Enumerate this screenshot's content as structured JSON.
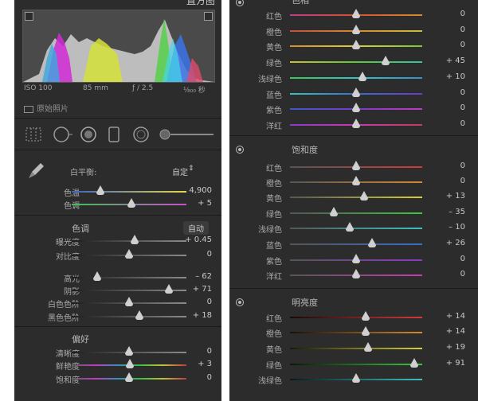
{
  "histogram": {
    "title": "直方图",
    "iso": "ISO 100",
    "focal": "85 mm",
    "aperture": "ƒ / 2.5",
    "shutter": "¹⁄₈₀₀ 秒",
    "original_photo_label": "原始照片"
  },
  "basic": {
    "wb_label": "白平衡:",
    "wb_value": "自定",
    "temp": {
      "label": "色温",
      "value": "4,900",
      "pos": 0.25
    },
    "tint": {
      "label": "色调",
      "value": "+ 5",
      "pos": 0.52
    },
    "tone_title": "色调",
    "auto_label": "自动",
    "exposure": {
      "label": "曝光度",
      "value": "+ 0.45",
      "pos": 0.55
    },
    "contrast": {
      "label": "对比度",
      "value": "0",
      "pos": 0.5
    },
    "highlights": {
      "label": "高光",
      "value": "– 62",
      "pos": 0.22
    },
    "shadows": {
      "label": "阴影",
      "value": "+ 71",
      "pos": 0.85
    },
    "whites": {
      "label": "白色色阶",
      "value": "0",
      "pos": 0.5
    },
    "blacks": {
      "label": "黑色色阶",
      "value": "+ 18",
      "pos": 0.59
    },
    "presence_title": "偏好",
    "clarity": {
      "label": "清晰度",
      "value": "0",
      "pos": 0.5
    },
    "vibrance": {
      "label": "鲜艳度",
      "value": "+ 3",
      "pos": 0.51
    },
    "saturation": {
      "label": "饱和度",
      "value": "0",
      "pos": 0.5
    }
  },
  "hsl": {
    "hue_title": "色相",
    "sat_title": "饱和度",
    "lum_title": "明亮度",
    "hue": [
      {
        "label": "红色",
        "value": "0",
        "pos": 0.5
      },
      {
        "label": "橙色",
        "value": "0",
        "pos": 0.5
      },
      {
        "label": "黄色",
        "value": "0",
        "pos": 0.5
      },
      {
        "label": "绿色",
        "value": "+ 45",
        "pos": 0.72
      },
      {
        "label": "浅绿色",
        "value": "+ 10",
        "pos": 0.55
      },
      {
        "label": "蓝色",
        "value": "0",
        "pos": 0.5
      },
      {
        "label": "紫色",
        "value": "0",
        "pos": 0.5
      },
      {
        "label": "洋红",
        "value": "0",
        "pos": 0.5
      }
    ],
    "sat": [
      {
        "label": "红色",
        "value": "0",
        "pos": 0.5
      },
      {
        "label": "橙色",
        "value": "0",
        "pos": 0.5
      },
      {
        "label": "黄色",
        "value": "+ 13",
        "pos": 0.56
      },
      {
        "label": "绿色",
        "value": "– 35",
        "pos": 0.33
      },
      {
        "label": "浅绿色",
        "value": "– 10",
        "pos": 0.45
      },
      {
        "label": "蓝色",
        "value": "+ 26",
        "pos": 0.62
      },
      {
        "label": "紫色",
        "value": "0",
        "pos": 0.5
      },
      {
        "label": "洋红",
        "value": "0",
        "pos": 0.5
      }
    ],
    "lum": [
      {
        "label": "红色",
        "value": "+ 14",
        "pos": 0.57
      },
      {
        "label": "橙色",
        "value": "+ 14",
        "pos": 0.57
      },
      {
        "label": "黄色",
        "value": "+ 19",
        "pos": 0.59
      },
      {
        "label": "绿色",
        "value": "+ 91",
        "pos": 0.94
      },
      {
        "label": "浅绿色",
        "value": "",
        "pos": 0.5
      }
    ]
  }
}
